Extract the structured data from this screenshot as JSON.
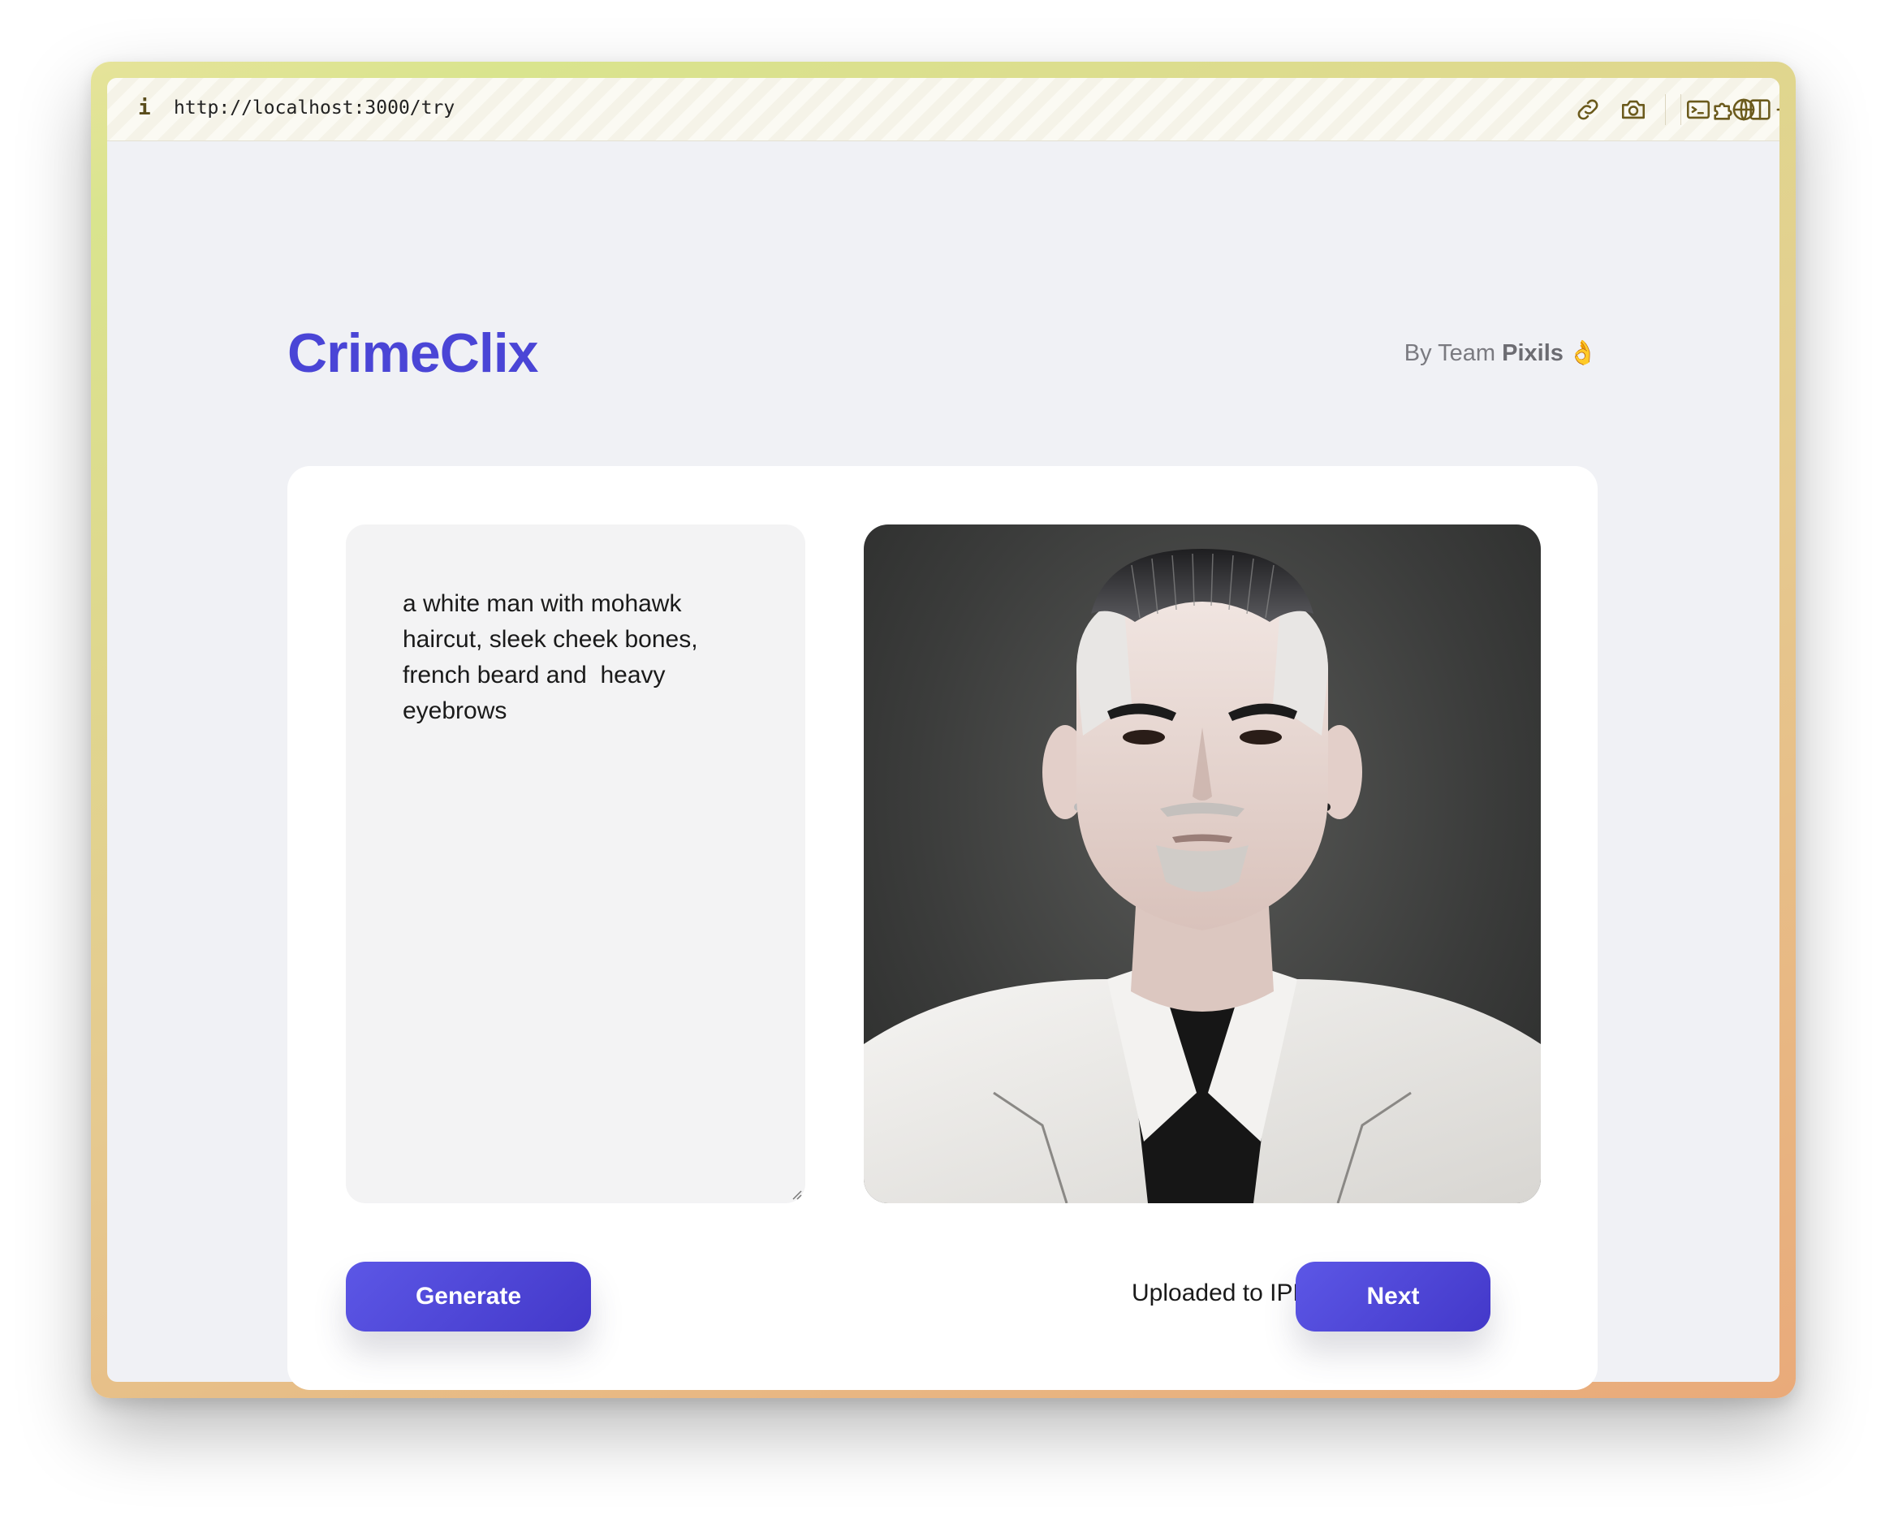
{
  "browser": {
    "url": "http://localhost:3000/try",
    "info_icon": "i",
    "toolbar_icons": [
      "link-icon",
      "camera-icon",
      "terminal-icon",
      "globe-icon",
      "crosshair-icon",
      "puzzle-icon",
      "sidebar-icon"
    ]
  },
  "header": {
    "logo": "CrimeClix",
    "byline_prefix": "By Team ",
    "byline_team": "Pixils",
    "byline_emoji": "👌"
  },
  "generator": {
    "prompt": "a white man with mohawk haircut, sleek cheek bones, french beard and  heavy eyebrows",
    "generate_label": "Generate",
    "status_text": "Uploaded to IPFS",
    "next_label": "Next"
  },
  "colors": {
    "accent": "#4a45d6",
    "button_start": "#5c57e6",
    "button_end": "#4338c9",
    "page_bg": "#f0f1f5"
  }
}
